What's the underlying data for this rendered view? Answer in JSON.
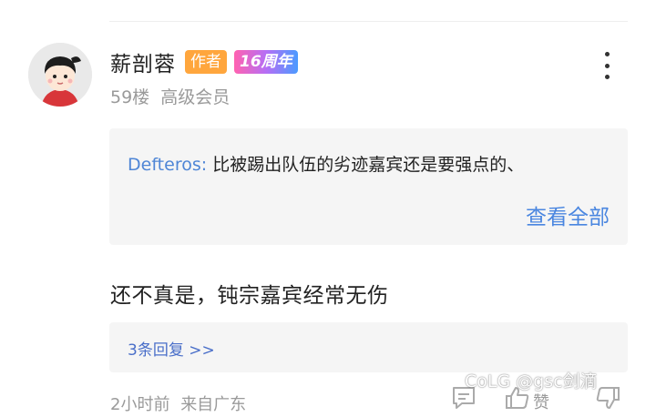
{
  "user": {
    "name": "薪剖蓉",
    "badge_author": "作者",
    "badge_anniversary": "16周年",
    "floor": "59楼",
    "level": "高级会员"
  },
  "quote": {
    "author": "Defteros:",
    "text": "比被踢出队伍的劣迹嘉宾还是要强点的、",
    "view_all": "查看全部"
  },
  "comment": {
    "text": "还不真是，钝宗嘉宾经常无伤"
  },
  "replies": {
    "link": "3条回复 >>"
  },
  "footer": {
    "time": "2小时前",
    "location": "来自广东",
    "like_label": "赞"
  },
  "watermark": {
    "text": "CoLG @gsc剑滴"
  },
  "icons": {
    "more": "more-vertical-icon",
    "reply": "comment-icon",
    "like": "thumbs-up-icon",
    "dislike": "thumbs-down-icon"
  },
  "colors": {
    "author_badge": "#ffa63d",
    "link_blue": "#4a86e0",
    "quote_author_blue": "#4f86d6",
    "muted_gray": "#9a9a9a"
  }
}
